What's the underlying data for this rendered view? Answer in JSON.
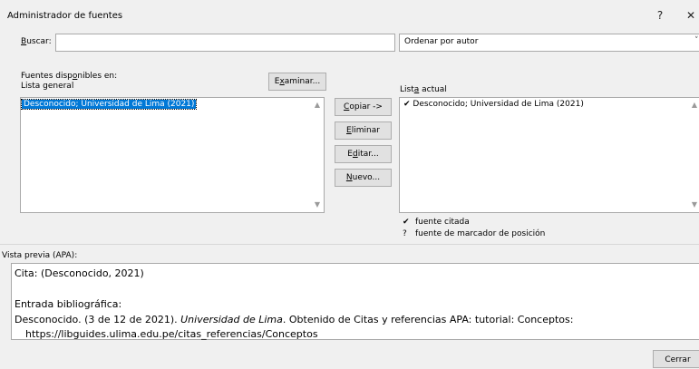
{
  "window": {
    "title": "Administrador de fuentes",
    "help": "?",
    "close": "✕"
  },
  "search": {
    "label_pre": "",
    "label_key": "B",
    "label_post": "uscar:",
    "value": "",
    "sort_selected": "Ordenar por autor",
    "sort_arrow": "˅"
  },
  "sources_available": {
    "label_line1_pre": "Fuentes disp",
    "label_line1_key": "o",
    "label_line1_post": "nibles en:",
    "label_line2": "Lista general",
    "browse_pre": "E",
    "browse_key": "x",
    "browse_post": "aminar...",
    "items": [
      "Desconocido; Universidad de Lima (2021)"
    ],
    "scroll_up": "▲",
    "scroll_down": "▼"
  },
  "actions": {
    "copy_key": "C",
    "copy_post": "opiar ->",
    "delete_key": "E",
    "delete_post": "liminar",
    "edit_pre": "E",
    "edit_key": "d",
    "edit_post": "itar...",
    "new_key": "N",
    "new_post": "uevo..."
  },
  "current_list": {
    "label_pre": "List",
    "label_key": "a",
    "label_post": " actual",
    "items": [
      {
        "mark": "✔",
        "text": "Desconocido; Universidad de Lima (2021)"
      }
    ],
    "scroll_up": "▲",
    "scroll_down": "▼"
  },
  "legend": [
    {
      "mark": "✔",
      "text": "fuente citada"
    },
    {
      "mark": "?",
      "text": "fuente de marcador de posición"
    }
  ],
  "preview": {
    "label": "Vista previa (APA):",
    "cita": "Cita:  (Desconocido, 2021)",
    "entrada": "Entrada bibliográfica:",
    "ref_pre": "Desconocido. (3 de 12 de 2021). ",
    "ref_italic": "Universidad de Lima",
    "ref_post": ". Obtenido de Citas y referencias APA: tutorial: Conceptos:",
    "ref_url": "https://libguides.ulima.edu.pe/citas_referencias/Conceptos"
  },
  "footer": {
    "close_label": "Cerrar"
  }
}
